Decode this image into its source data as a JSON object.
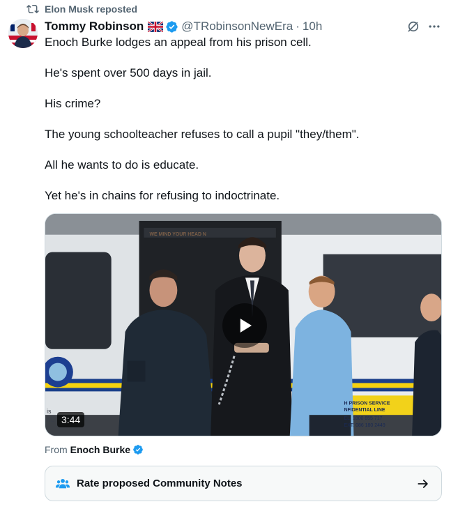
{
  "repost": {
    "text": "Elon Musk reposted",
    "icon": "repost-icon"
  },
  "author": {
    "name": "Tommy Robinson",
    "flag_icon": "uk-flag-icon",
    "verified_icon": "verified-badge-icon",
    "handle": "@TRobinsonNewEra",
    "separator": "·",
    "time": "10h"
  },
  "actions": {
    "grok_icon": "grok-icon",
    "more_icon": "more-icon"
  },
  "tweet": {
    "paragraphs": [
      "Enoch Burke lodges an appeal from his prison cell.",
      "He's spent over 500 days in jail.",
      "His crime?",
      "The young schoolteacher refuses to call a pupil \"they/them\".",
      "All he wants to do is educate.",
      "Yet he's in chains for refusing to indoctrinate."
    ]
  },
  "media": {
    "type": "video",
    "duration": "3:44",
    "play_icon": "play-icon",
    "van_text": {
      "top": "WE MIND YOUR HEAD N",
      "left": "is",
      "left2": "nE",
      "sign_line1": "H PRISON SERVICE",
      "sign_line2": "NFIDENTIAL LINE",
      "sign_line3": "EL: 1800 855 717",
      "sign_line4": "EXT: 086 180 2449"
    }
  },
  "source": {
    "label": "From",
    "name": "Enoch Burke",
    "verified_icon": "verified-badge-icon"
  },
  "community_notes": {
    "label": "Rate proposed Community Notes",
    "icon": "people-icon",
    "arrow_icon": "arrow-right-icon"
  },
  "colors": {
    "text_primary": "#0f1419",
    "text_secondary": "#536471",
    "verified_blue": "#1d9bf0",
    "border": "#cfd9de"
  }
}
